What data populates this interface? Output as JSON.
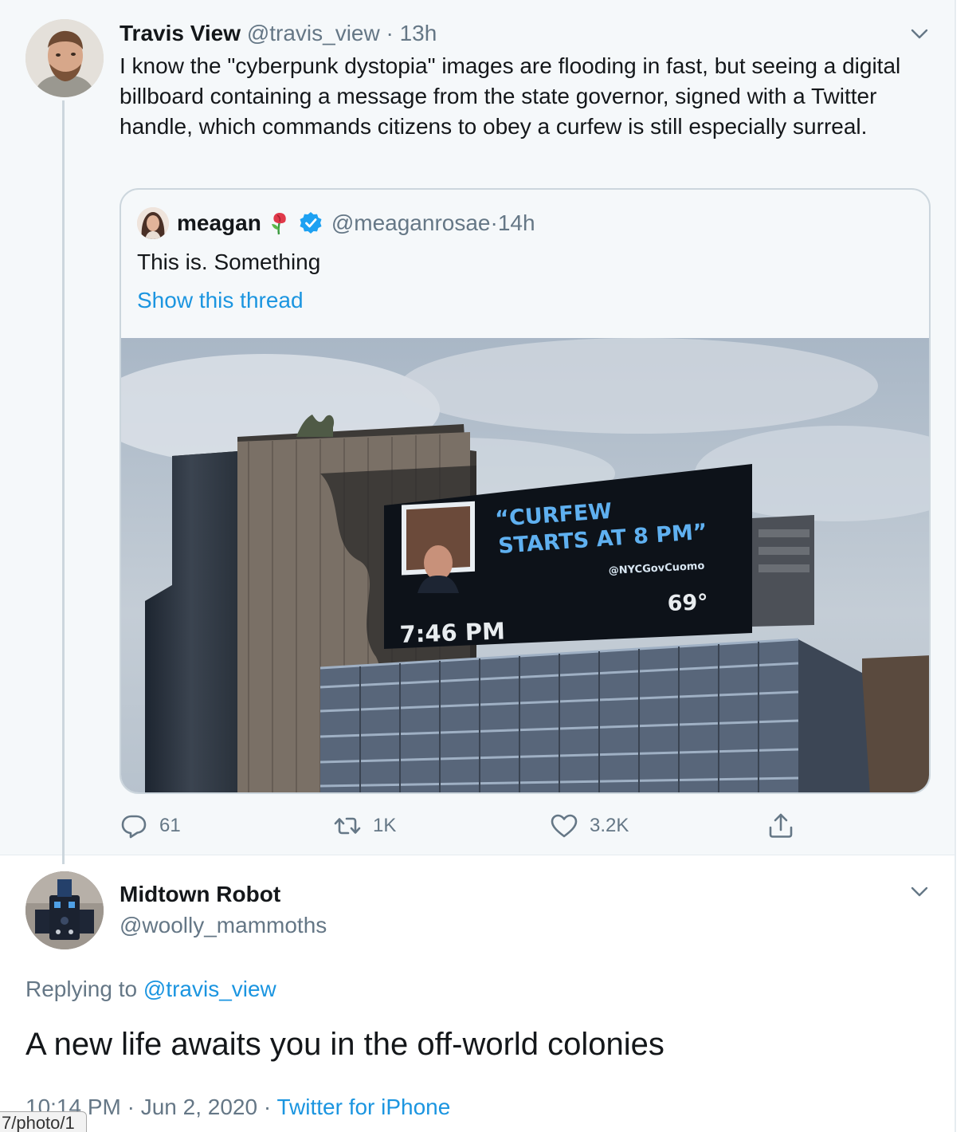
{
  "parent_tweet": {
    "name": "Travis View",
    "handle": "@travis_view",
    "time": "13h",
    "text": "I know the \"cyberpunk dystopia\" images are flooding in fast, but seeing a digital billboard containing a message from the state governor, signed with a Twitter handle, which commands citizens to obey a curfew is still especially surreal.",
    "counts": {
      "replies": "61",
      "retweets": "1K",
      "likes": "3.2K"
    }
  },
  "quoted_tweet": {
    "name": "meagan",
    "handle": "@meaganrosae",
    "time": "14h",
    "text": "This is. Something",
    "show_thread": "Show this thread",
    "photo": {
      "billboard_line1": "“CURFEW",
      "billboard_line2": "STARTS AT 8 PM”",
      "billboard_handle": "@NYCGovCuomo",
      "billboard_time": "7:46 PM",
      "billboard_temp": "69°"
    }
  },
  "reply_tweet": {
    "name": "Midtown Robot",
    "handle": "@woolly_mammoths",
    "replying_prefix": "Replying to ",
    "replying_to": "@travis_view",
    "text": "A new life awaits you in the off-world colonies",
    "timestamp": "10:14 PM · Jun 2, 2020 · ",
    "source": "Twitter for iPhone"
  },
  "status_bar_url": "7/photo/1",
  "separator": " · ",
  "colors": {
    "link": "#1b95e0",
    "muted": "#657786",
    "text": "#14171a",
    "verified": "#1da1f2"
  },
  "icons": [
    "chevron-down-icon",
    "reply-icon",
    "retweet-icon",
    "like-icon",
    "share-icon",
    "verified-badge-icon",
    "rose-emoji-icon"
  ]
}
